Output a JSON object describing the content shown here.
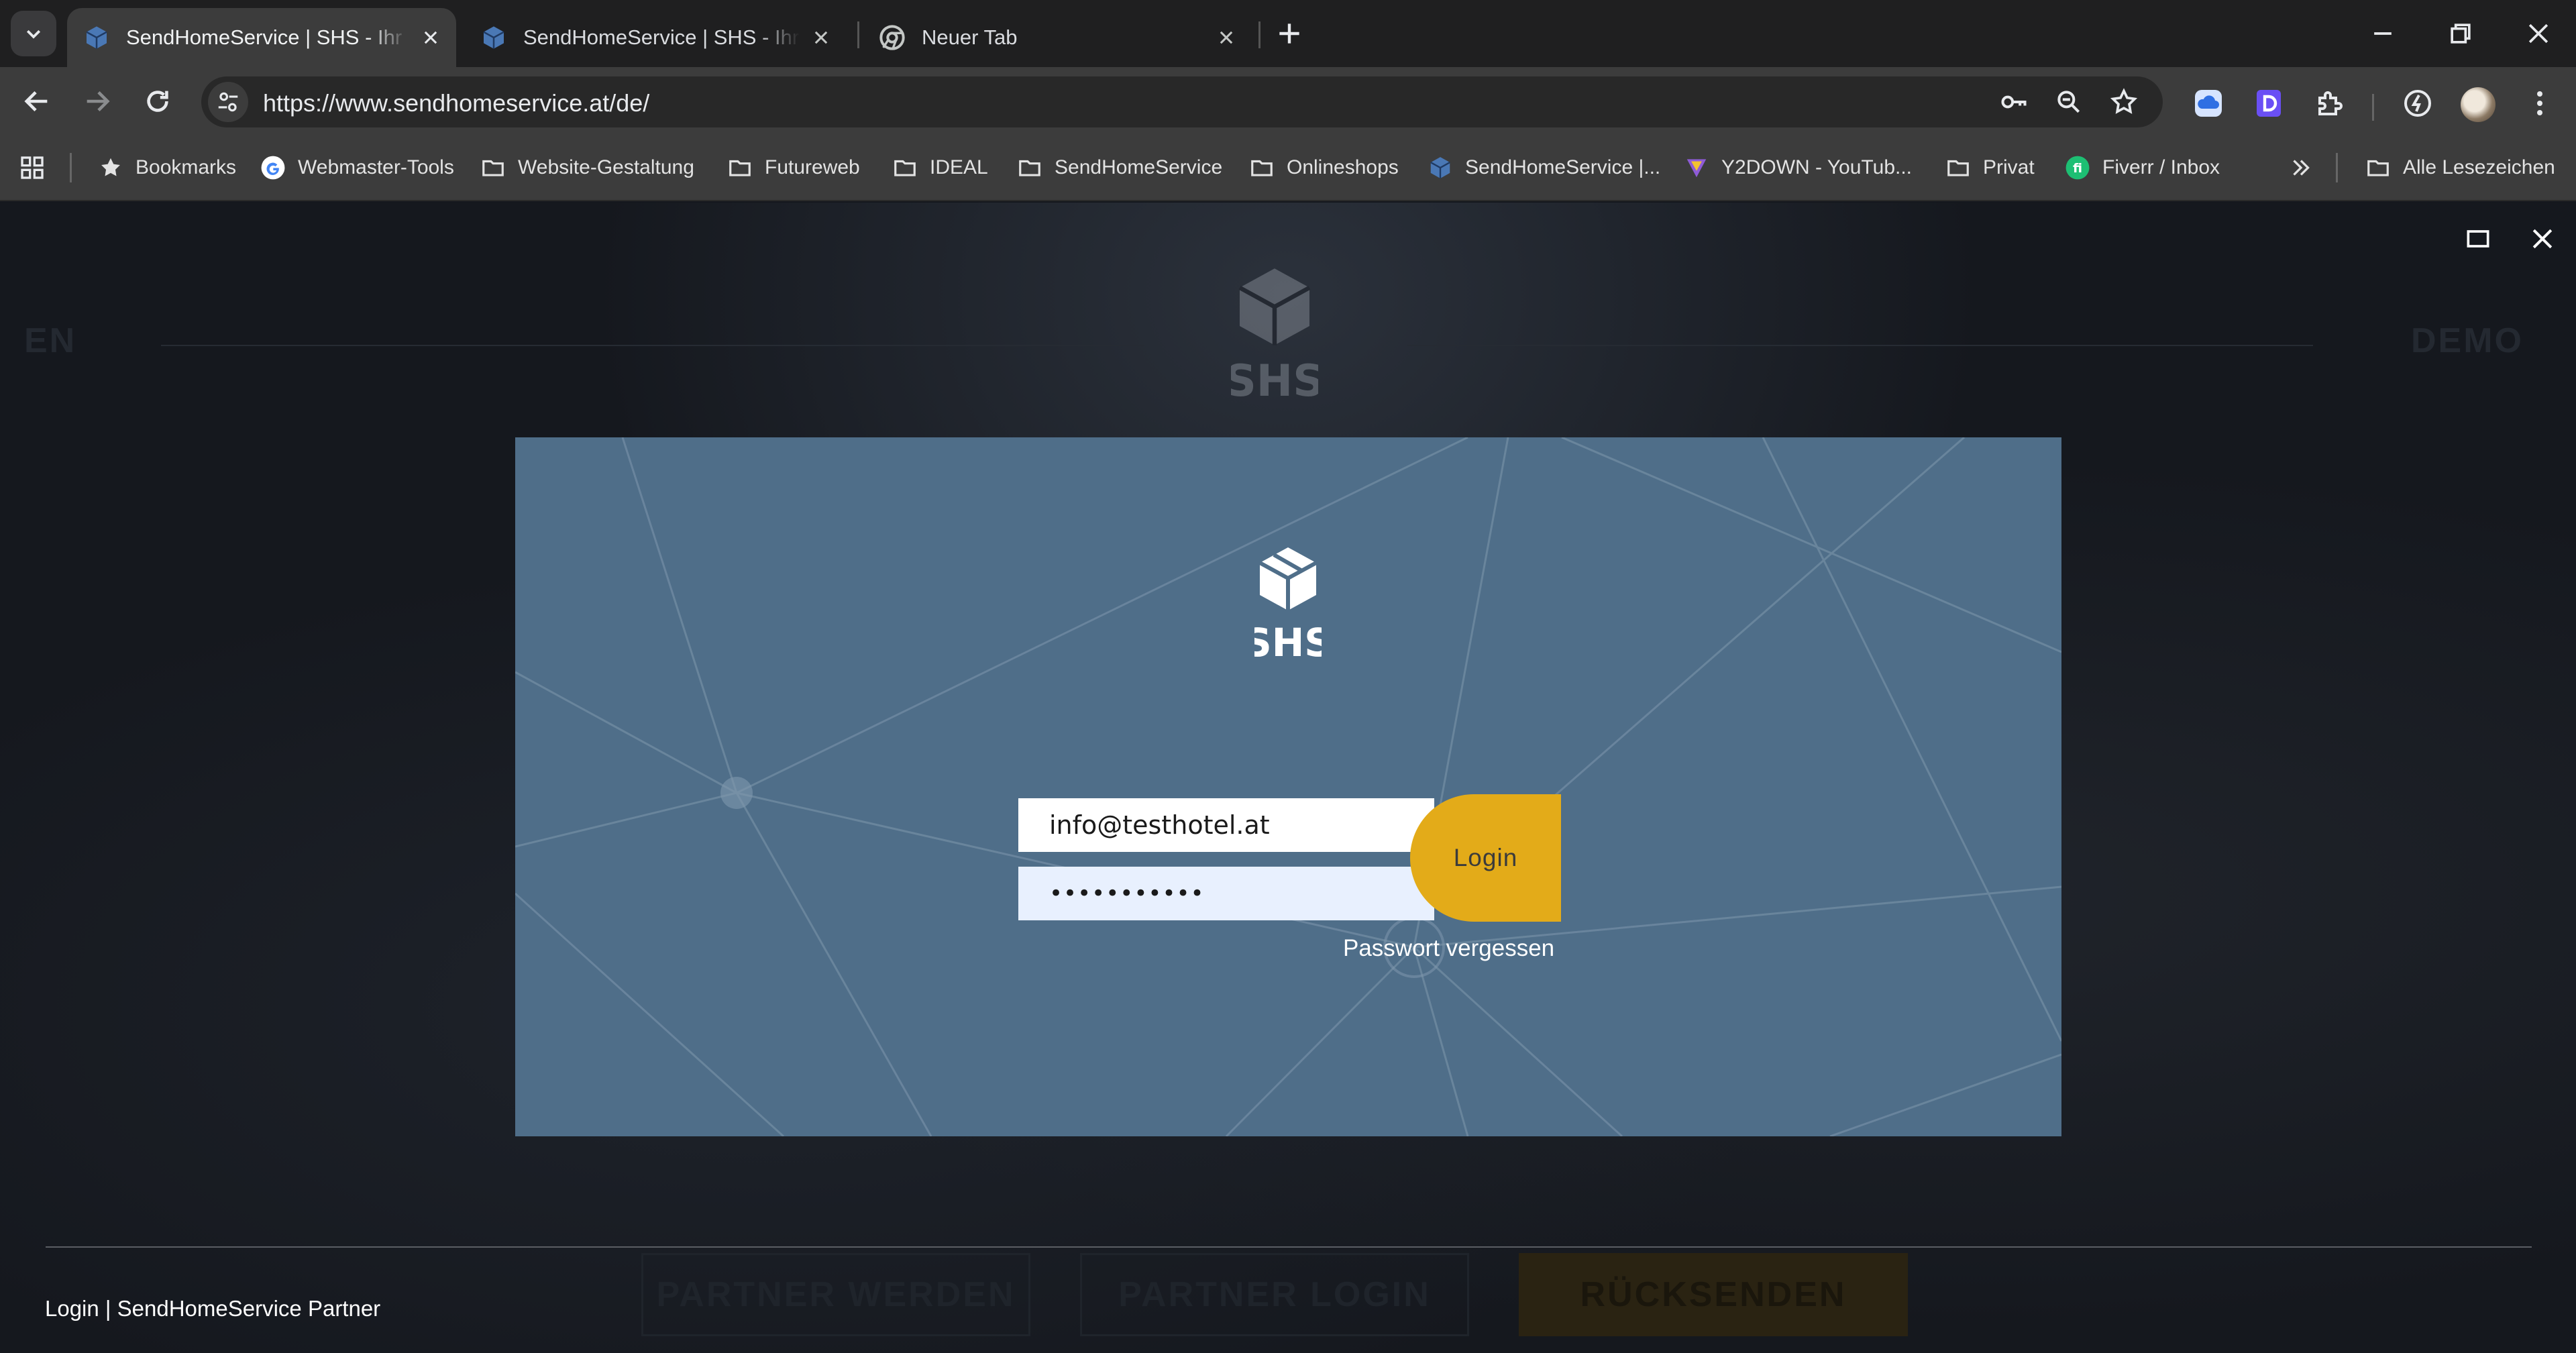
{
  "browser": {
    "tabs": [
      {
        "title": "SendHomeService | SHS - Ihr pr",
        "active": true
      },
      {
        "title": "SendHomeService | SHS - Ihr pr",
        "active": false
      },
      {
        "title": "Neuer Tab",
        "active": false
      }
    ],
    "url": "https://www.sendhomeservice.at/de/",
    "bookmarks": [
      {
        "label": "Bookmarks",
        "icon": "star-icon"
      },
      {
        "label": "Webmaster-Tools",
        "icon": "google-icon"
      },
      {
        "label": "Website-Gestaltung",
        "icon": "folder-icon"
      },
      {
        "label": "Futureweb",
        "icon": "folder-icon"
      },
      {
        "label": "IDEAL",
        "icon": "folder-icon"
      },
      {
        "label": "SendHomeService",
        "icon": "folder-icon"
      },
      {
        "label": "Onlineshops",
        "icon": "folder-icon"
      },
      {
        "label": "SendHomeService |...",
        "icon": "shs-cube-icon"
      },
      {
        "label": "Y2DOWN - YouTub...",
        "icon": "y2down-icon"
      },
      {
        "label": "Privat",
        "icon": "folder-icon"
      },
      {
        "label": "Fiverr / Inbox",
        "icon": "fiverr-icon"
      }
    ],
    "all_bookmarks": "Alle Lesezeichen"
  },
  "background_page": {
    "language": "EN",
    "demo": "DEMO",
    "logo_text": "SHS",
    "buttons": [
      "PARTNER WERDEN",
      "PARTNER LOGIN",
      "RÜCKSENDEN"
    ]
  },
  "modal": {
    "logo_text": "SHS",
    "email_value": "info@testhotel.at",
    "password_mask": "•••••••••••",
    "login_label": "Login",
    "forgot_label": "Passwort vergessen"
  },
  "footer": {
    "caption": "Login | SendHomeService Partner"
  },
  "colors": {
    "modal_bg": "#4f6e89",
    "login_button": "#e3ab19",
    "page_bg": "#15181e"
  }
}
